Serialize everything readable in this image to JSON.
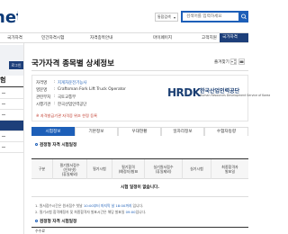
{
  "header": {
    "logo_text": "net",
    "search_scope": "통합검색",
    "search_placeholder": "검색어를 입력하세요"
  },
  "nav": {
    "items": [
      "국가자격",
      "민간자격시험",
      "자격종목안내",
      "마이페이지",
      "고객지원"
    ],
    "active_item": "국가자격"
  },
  "sidebar": {
    "login_button": "로그인",
    "heading": "험"
  },
  "page": {
    "title": "국가자격 종목별 상세정보",
    "bookmark_label": "즐겨찾기"
  },
  "info": {
    "rows": [
      {
        "label": "자격명",
        "value": "지게차운전기능사",
        "is_link": true
      },
      {
        "label": "영문명",
        "value": "Craftsman Fork Lift Truck Operator",
        "is_link": false
      },
      {
        "label": "관련부처",
        "value": "국토교통부",
        "is_link": false
      },
      {
        "label": "시행기관",
        "value": "한국산업인력공단",
        "is_link": false
      }
    ],
    "warning": "※ 자격발급기관 자격증 위조 한정 등록",
    "agency_logo": "HRDK",
    "agency_name_kr": "한국산업인력공단",
    "agency_name_en": "Human Resources Development Service of Korea"
  },
  "tabs": [
    "시험정보",
    "기본정보",
    "우대현황",
    "일자리정보",
    "수험자동향"
  ],
  "active_tab": "시험정보",
  "schedule": {
    "section_title": "검정형 자격 시험일정",
    "columns": [
      "구분",
      "필기원서접수\n(인터넷)\n(휴일제외)",
      "필기시험",
      "필기합격\n(예정자)발표",
      "실기원서접수\n(휴일제외)",
      "실기시험",
      "최종합격자\n발표일"
    ],
    "empty_message": "시험 일정이 없습니다."
  },
  "notes": [
    {
      "prefix": "1. 원서접수시간은 원서접수 첫날 ",
      "highlight": "10:00부터 마지막 날 18:00까지",
      "suffix": " 입니다."
    },
    {
      "prefix": "2. 필기시험 합격예정자 및 최종합격자 발표시간은 해당 발표일 ",
      "highlight": "09:00",
      "suffix": "입니다."
    }
  ],
  "section2": {
    "title": "검정형 자격 시험일정",
    "partial_cell": "수수료"
  }
}
